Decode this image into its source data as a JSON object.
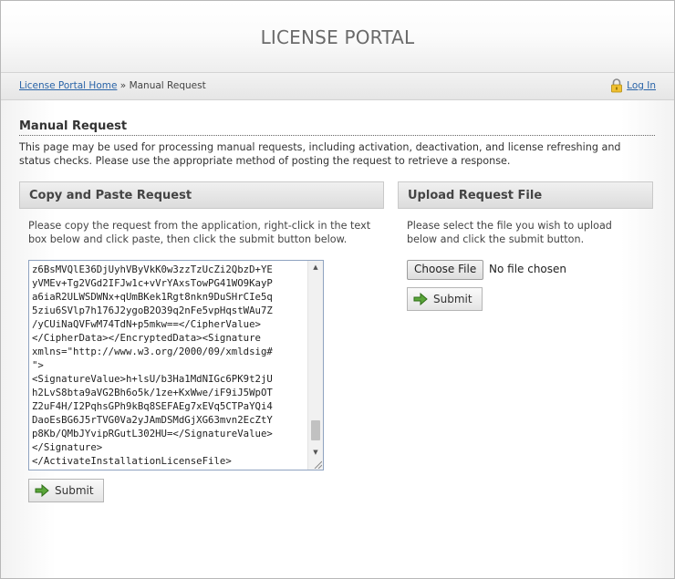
{
  "header": {
    "title": "LICENSE PORTAL"
  },
  "breadcrumb": {
    "home_link": "License Portal Home",
    "separator": "»",
    "current": "Manual Request"
  },
  "login": {
    "label": "Log In",
    "icon": "lock-icon"
  },
  "page": {
    "title": "Manual Request",
    "description": "This page may be used for processing manual requests, including activation, deactivation, and license refreshing and status checks. Please use the appropriate method of posting the request to retrieve a response."
  },
  "copy_paste": {
    "heading": "Copy and Paste Request",
    "instructions": "Please copy the request from the application, right-click in the text box below and click paste, then click the submit button below.",
    "textarea_value": "z6BsMVQlE36DjUyhVByVkK0w3zzTzUcZi2QbzD+YE\nyVMEv+Tg2VGd2IFJw1c+vVrYAxsTowPG41WO9KayP\na6iaR2ULWSDWNx+qUmBKek1Rgt8nkn9DuSHrCIe5q\n5ziu6SVlp7h176J2ygoB2O39q2nFe5vpHqstWAu7Z\n/yCUiNaQVFwM74TdN+p5mkw==</CipherValue>\n</CipherData></EncryptedData><Signature\nxmlns=\"http://www.w3.org/2000/09/xmldsig#\n\">\n<SignatureValue>h+lsU/b3Ha1MdNIGc6PK9t2jU\nh2LvS8bta9aVG2Bh6o5k/1ze+KxWwe/iF9iJ5WpOT\nZ2uF4H/I2PqhsGPh9kBq8SEFAEg7xEVq5CTPaYQi4\nDaoEsBG6J5rTVG0Va2yJAmDSMdGjXG63mvn2EcZtY\np8Kb/QMbJYvipRGutL302HU=</SignatureValue>\n</Signature>\n</ActivateInstallationLicenseFile>",
    "submit_label": "Submit"
  },
  "upload": {
    "heading": "Upload Request File",
    "instructions": "Please select the file you wish to upload below and click the submit button.",
    "choose_file_label": "Choose File",
    "file_status": "No file chosen",
    "submit_label": "Submit"
  },
  "colors": {
    "link": "#2a64a8",
    "submit_arrow": "#4a9a2a"
  }
}
